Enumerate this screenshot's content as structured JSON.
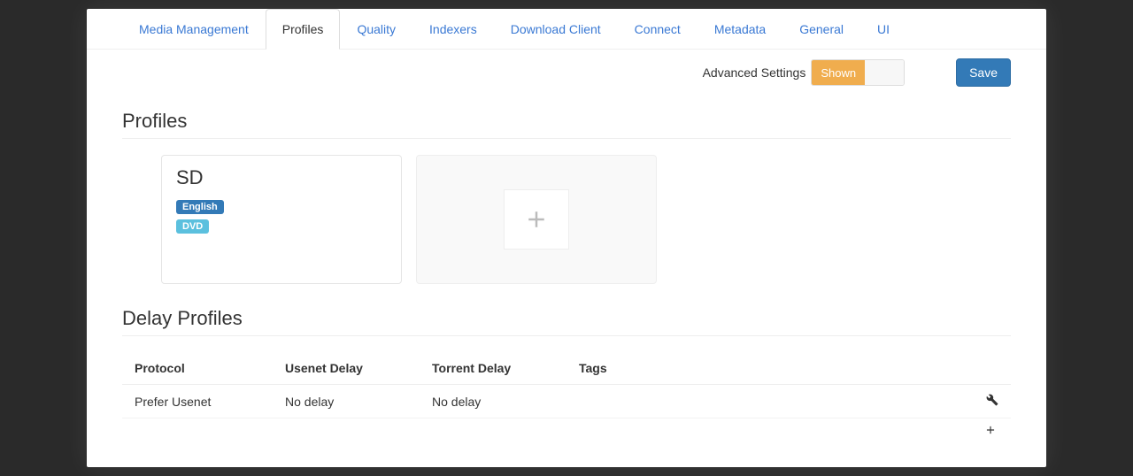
{
  "tabs": [
    {
      "label": "Media Management",
      "active": false
    },
    {
      "label": "Profiles",
      "active": true
    },
    {
      "label": "Quality",
      "active": false
    },
    {
      "label": "Indexers",
      "active": false
    },
    {
      "label": "Download Client",
      "active": false
    },
    {
      "label": "Connect",
      "active": false
    },
    {
      "label": "Metadata",
      "active": false
    },
    {
      "label": "General",
      "active": false
    },
    {
      "label": "UI",
      "active": false
    }
  ],
  "advanced": {
    "label": "Advanced Settings",
    "state": "Shown"
  },
  "save": "Save",
  "sections": {
    "profiles_title": "Profiles",
    "delay_title": "Delay Profiles"
  },
  "profile_card": {
    "name": "SD",
    "language": "English",
    "quality": "DVD"
  },
  "delay_table": {
    "headers": {
      "protocol": "Protocol",
      "usenet": "Usenet Delay",
      "torrent": "Torrent Delay",
      "tags": "Tags"
    },
    "row": {
      "protocol": "Prefer Usenet",
      "usenet": "No delay",
      "torrent": "No delay",
      "tags": ""
    }
  }
}
